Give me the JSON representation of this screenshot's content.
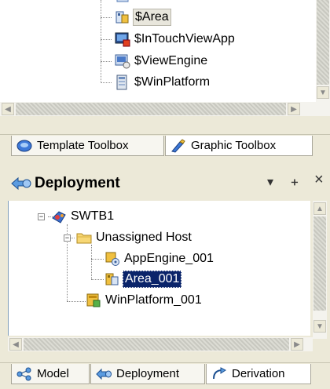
{
  "template_tree": {
    "items": [
      {
        "label": "$Area",
        "icon": "area-icon"
      },
      {
        "label": "$InTouchViewApp",
        "icon": "intouch-viewapp-icon"
      },
      {
        "label": "$ViewEngine",
        "icon": "view-engine-icon"
      },
      {
        "label": "$WinPlatform",
        "icon": "winplatform-icon"
      }
    ]
  },
  "top_tabs": [
    {
      "label": "Template Toolbox",
      "icon": "template-toolbox-icon",
      "active": false
    },
    {
      "label": "Graphic Toolbox",
      "icon": "graphic-toolbox-icon",
      "active": true
    }
  ],
  "deployment_panel": {
    "title": "Deployment",
    "controls": {
      "dropdown": "▾",
      "pin": "ᚐ",
      "close": "×"
    },
    "tree": [
      {
        "label": "SWTB1",
        "icon": "galaxy-icon",
        "level": 0,
        "expander": "−"
      },
      {
        "label": "Unassigned Host",
        "icon": "folder-icon",
        "level": 1,
        "expander": "−"
      },
      {
        "label": "AppEngine_001",
        "icon": "appengine-icon",
        "level": 2
      },
      {
        "label": "Area_001",
        "icon": "area-icon",
        "level": 2,
        "selected": true
      },
      {
        "label": "WinPlatform_001",
        "icon": "winplatform-icon",
        "level": 1
      }
    ]
  },
  "bottom_tabs": [
    {
      "label": "Model",
      "icon": "model-icon",
      "active": false
    },
    {
      "label": "Deployment",
      "icon": "deployment-icon",
      "active": false
    },
    {
      "label": "Derivation",
      "icon": "derivation-icon",
      "active": true
    }
  ]
}
